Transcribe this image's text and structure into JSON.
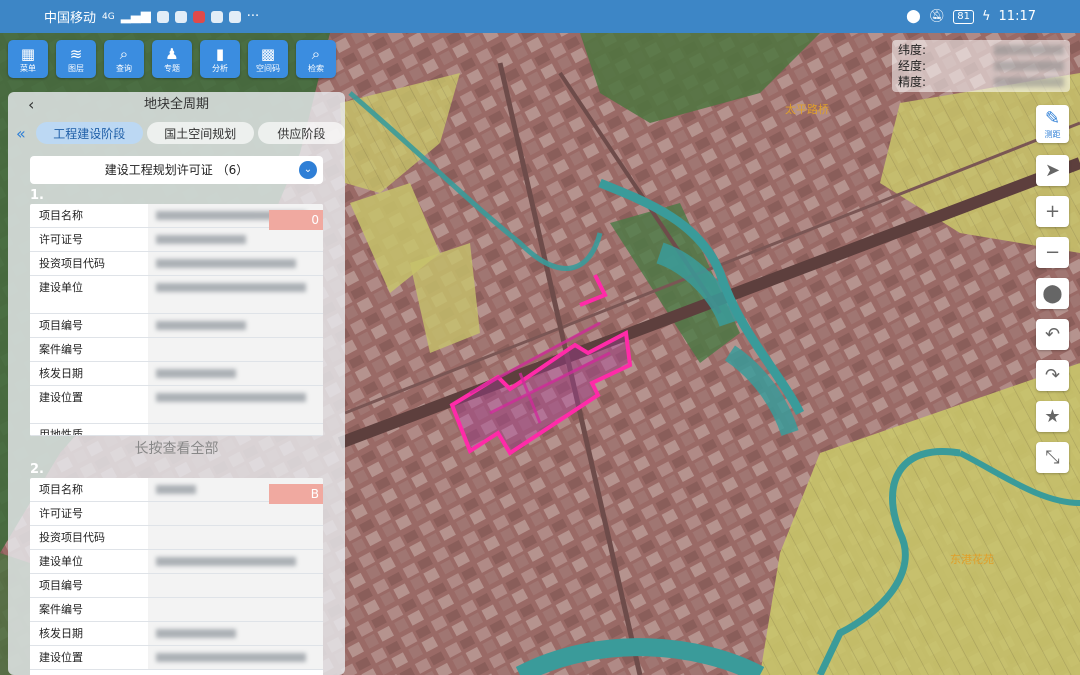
{
  "statusbar": {
    "carrier": "中国移动",
    "signal": "4G",
    "battery": "81",
    "time": "11:17"
  },
  "toolbar": [
    {
      "label": "菜单",
      "icon": "grid-icon",
      "glyph": "▦"
    },
    {
      "label": "图层",
      "icon": "layers-icon",
      "glyph": "≋"
    },
    {
      "label": "查询",
      "icon": "search-icon",
      "glyph": "⌕"
    },
    {
      "label": "专题",
      "icon": "person-icon",
      "glyph": "♟"
    },
    {
      "label": "分析",
      "icon": "bar-chart-icon",
      "glyph": "▮"
    },
    {
      "label": "空间码",
      "icon": "qr-code-icon",
      "glyph": "▩"
    },
    {
      "label": "检索",
      "icon": "search-icon",
      "glyph": "⌕"
    }
  ],
  "coords": {
    "lat_label": "纬度:",
    "lng_label": "经度:",
    "acc_label": "精度:"
  },
  "map_controls": {
    "measure_label": "测距"
  },
  "panel": {
    "title": "地块全周期",
    "tabs": [
      "工程建设阶段",
      "国土空间规划",
      "供应阶段"
    ],
    "active_tab": 0,
    "dropdown": "建设工程规划许可证 （6）",
    "long_press_hint": "长按查看全部",
    "records": [
      {
        "index": "1.",
        "fields": [
          "项目名称",
          "许可证号",
          "投资项目代码",
          "建设单位",
          "项目编号",
          "案件编号",
          "核发日期",
          "建设位置",
          "用地性质"
        ],
        "badge": "0"
      },
      {
        "index": "2.",
        "fields": [
          "项目名称",
          "许可证号",
          "投资项目代码",
          "建设单位",
          "项目编号",
          "案件编号",
          "核发日期",
          "建设位置"
        ],
        "badge": "B"
      }
    ]
  },
  "map_labels": {
    "top_place": "太平路桥",
    "right_place": "东港花苑"
  }
}
